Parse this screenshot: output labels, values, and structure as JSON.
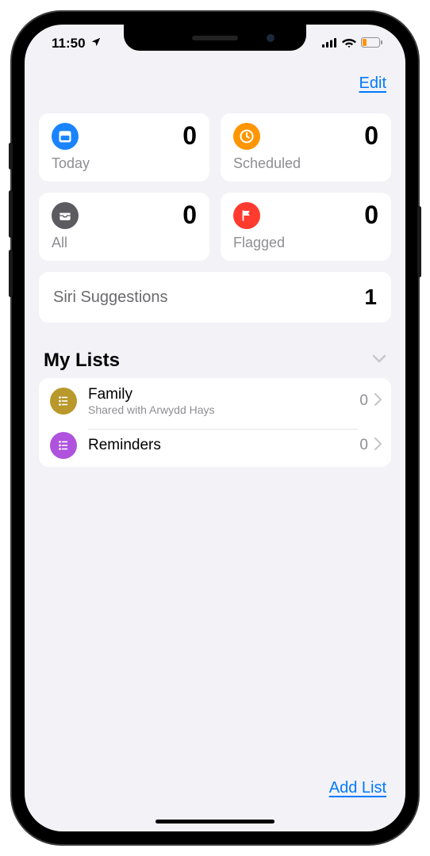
{
  "status": {
    "time": "11:50"
  },
  "nav": {
    "edit": "Edit"
  },
  "cards": {
    "today": {
      "label": "Today",
      "count": "0",
      "icon": "calendar-icon",
      "color": "#1a84ff"
    },
    "scheduled": {
      "label": "Scheduled",
      "count": "0",
      "icon": "clock-icon",
      "color": "#ff9500"
    },
    "all": {
      "label": "All",
      "count": "0",
      "icon": "tray-icon",
      "color": "#5b5b60"
    },
    "flagged": {
      "label": "Flagged",
      "count": "0",
      "icon": "flag-icon",
      "color": "#ff3b30"
    }
  },
  "siri": {
    "label": "Siri Suggestions",
    "count": "1"
  },
  "sections": {
    "mylists": {
      "title": "My Lists"
    }
  },
  "lists": [
    {
      "name": "Family",
      "sub": "Shared with Arwydd Hays",
      "count": "0",
      "color": "#b9982c"
    },
    {
      "name": "Reminders",
      "sub": "",
      "count": "0",
      "color": "#af52de"
    }
  ],
  "toolbar": {
    "add": "Add List"
  }
}
